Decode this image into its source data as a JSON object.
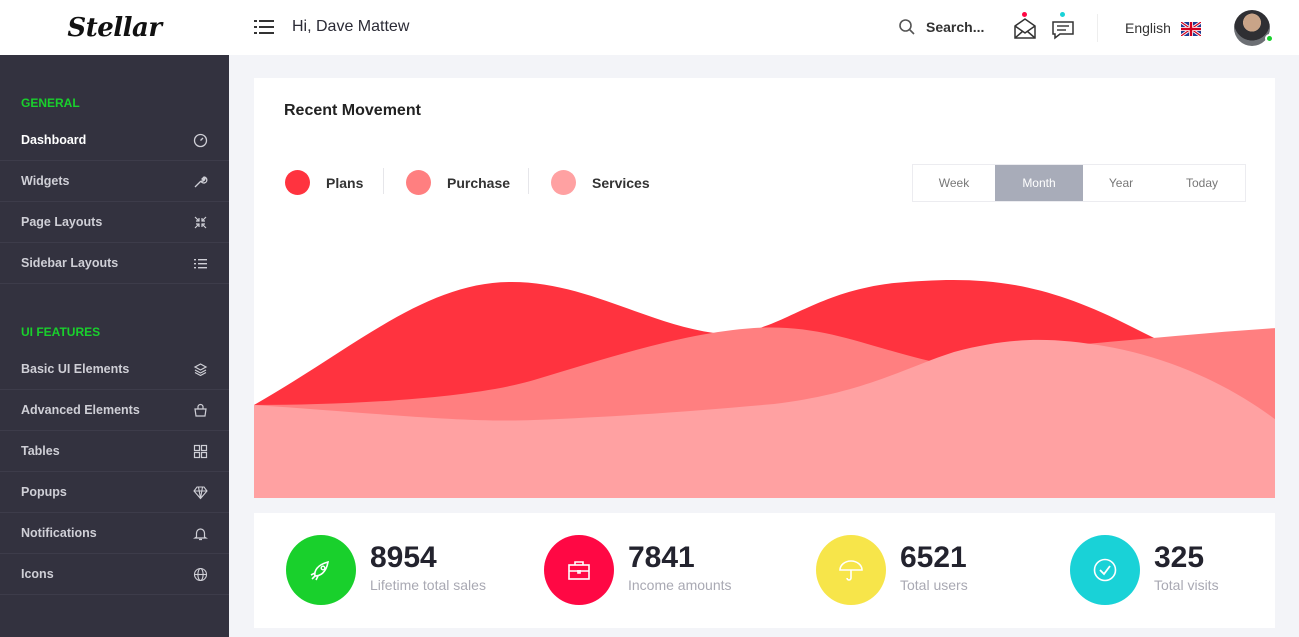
{
  "brand": {
    "name": "Stellar"
  },
  "header": {
    "greeting": "Hi, Dave Mattew",
    "search_label": "Search...",
    "language": "English",
    "icons": [
      "menu-icon",
      "search-icon",
      "mail-icon",
      "chat-icon",
      "uk-flag-icon"
    ]
  },
  "sidebar": {
    "sections": [
      {
        "title": "GENERAL"
      },
      {
        "title": "UI FEATURES"
      }
    ],
    "items": [
      {
        "label": "Dashboard",
        "icon": "gauge-icon",
        "active": true
      },
      {
        "label": "Widgets",
        "icon": "wrench-icon"
      },
      {
        "label": "Page Layouts",
        "icon": "compress-icon"
      },
      {
        "label": "Sidebar Layouts",
        "icon": "list-icon"
      },
      {
        "label": "Basic UI Elements",
        "icon": "layers-icon"
      },
      {
        "label": "Advanced Elements",
        "icon": "bag-icon"
      },
      {
        "label": "Tables",
        "icon": "grid-icon"
      },
      {
        "label": "Popups",
        "icon": "diamond-icon"
      },
      {
        "label": "Notifications",
        "icon": "bell-icon"
      },
      {
        "label": "Icons",
        "icon": "globe-icon"
      }
    ]
  },
  "movement": {
    "title": "Recent Movement",
    "legend": [
      {
        "label": "Plans",
        "color": "#ff333f"
      },
      {
        "label": "Purchase",
        "color": "#ff7f80"
      },
      {
        "label": "Services",
        "color": "#ffa1a2"
      }
    ],
    "tabs": [
      {
        "label": "Week"
      },
      {
        "label": "Month",
        "active": true
      },
      {
        "label": "Year"
      },
      {
        "label": "Today"
      }
    ]
  },
  "stats": [
    {
      "value": "8954",
      "label": "Lifetime total sales",
      "color": "#19d02c",
      "icon": "rocket-icon"
    },
    {
      "value": "7841",
      "label": "Income amounts",
      "color": "#ff0844",
      "icon": "briefcase-icon"
    },
    {
      "value": "6521",
      "label": "Total users",
      "color": "#f7e54a",
      "icon": "umbrella-icon"
    },
    {
      "value": "325",
      "label": "Total visits",
      "color": "#19d2d7",
      "icon": "check-circle-icon"
    }
  ]
}
